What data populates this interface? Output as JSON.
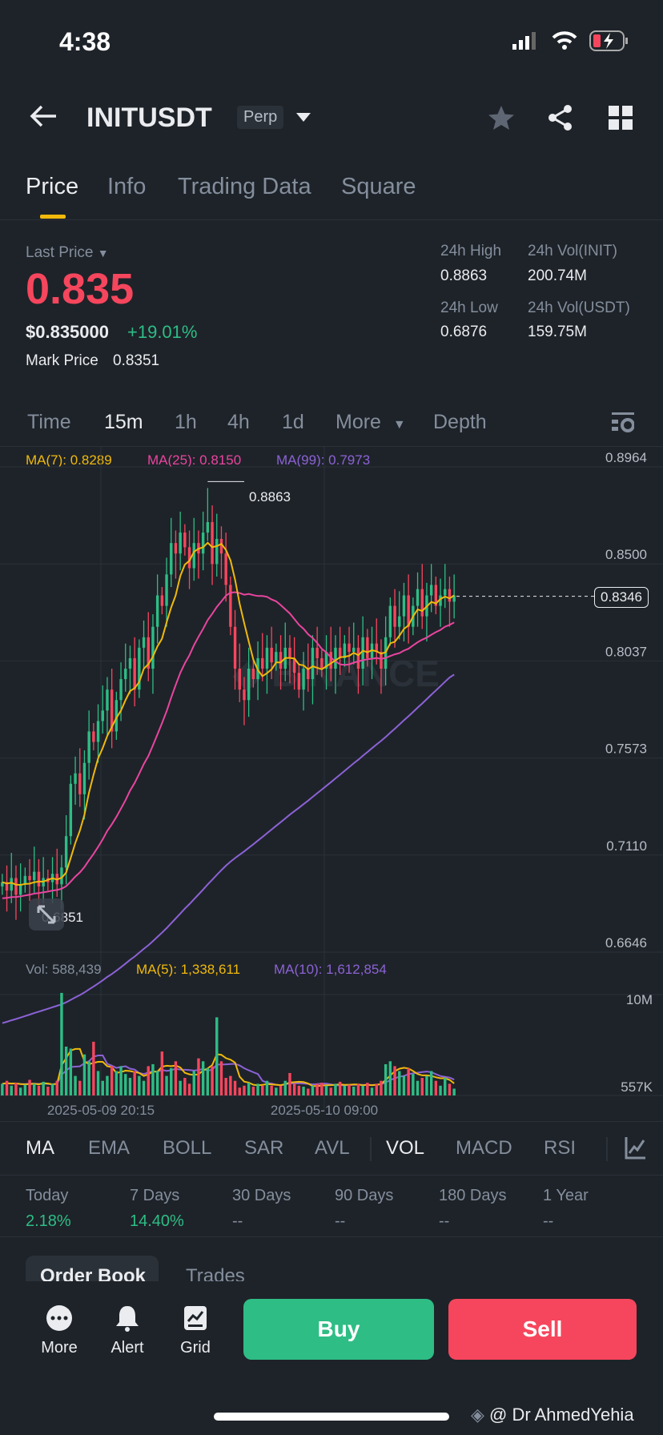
{
  "status": {
    "time": "4:38"
  },
  "header": {
    "symbol": "INITUSDT",
    "badge": "Perp"
  },
  "tabs": [
    "Price",
    "Info",
    "Trading Data",
    "Square"
  ],
  "ticker": {
    "last_price_label": "Last Price",
    "last_price": "0.835",
    "usd_price": "$0.835000",
    "change": "+19.01%",
    "mark_price_label": "Mark Price",
    "mark_price": "0.8351",
    "high_label": "24h High",
    "high": "0.8863",
    "low_label": "24h Low",
    "low": "0.6876",
    "vol_init_label": "24h Vol(INIT)",
    "vol_init": "200.74M",
    "vol_usdt_label": "24h Vol(USDT)",
    "vol_usdt": "159.75M"
  },
  "intervals": [
    "Time",
    "15m",
    "1h",
    "4h",
    "1d",
    "More",
    "Depth"
  ],
  "colors": {
    "up": "#2ebd85",
    "down": "#f6465d",
    "ma7": "#f0b90b",
    "ma25": "#e9459f",
    "ma99": "#8c62d6",
    "accent": "#f0b90b"
  },
  "chart_data": {
    "type": "candlestick",
    "ma_legend": {
      "ma7": "MA(7): 0.8289",
      "ma25": "MA(25): 0.8150",
      "ma99": "MA(99): 0.7973"
    },
    "y_ticks": [
      "0.8964",
      "0.8500",
      "0.8037",
      "0.7573",
      "0.7110",
      "0.6646"
    ],
    "ylim": [
      0.6646,
      0.8964
    ],
    "high_marker": "0.8863",
    "low_marker": "0.6851",
    "current_price_tag": "0.8346",
    "current_price": 0.8346,
    "closes": [
      0.698,
      0.694,
      0.7,
      0.692,
      0.697,
      0.701,
      0.699,
      0.703,
      0.696,
      0.7,
      0.698,
      0.702,
      0.697,
      0.705,
      0.72,
      0.745,
      0.75,
      0.74,
      0.755,
      0.77,
      0.765,
      0.775,
      0.78,
      0.79,
      0.77,
      0.785,
      0.795,
      0.8,
      0.805,
      0.79,
      0.81,
      0.815,
      0.8,
      0.82,
      0.835,
      0.83,
      0.845,
      0.86,
      0.855,
      0.865,
      0.858,
      0.848,
      0.86,
      0.855,
      0.865,
      0.87,
      0.85,
      0.862,
      0.855,
      0.84,
      0.82,
      0.8,
      0.79,
      0.785,
      0.8,
      0.795,
      0.805,
      0.8,
      0.81,
      0.803,
      0.808,
      0.8,
      0.81,
      0.805,
      0.798,
      0.79,
      0.8,
      0.795,
      0.81,
      0.805,
      0.8,
      0.808,
      0.8,
      0.81,
      0.805,
      0.812,
      0.808,
      0.81,
      0.8,
      0.815,
      0.805,
      0.812,
      0.808,
      0.8,
      0.815,
      0.83,
      0.82,
      0.825,
      0.835,
      0.82,
      0.83,
      0.838,
      0.825,
      0.835,
      0.84,
      0.83,
      0.835,
      0.838,
      0.832,
      0.835
    ],
    "volume_legend": {
      "vol": "Vol: 588,439",
      "ma5": "MA(5): 1,338,611",
      "ma10": "MA(10): 1,612,854"
    },
    "volume_ticks": [
      "10M",
      "557K"
    ],
    "volumes_m": [
      1.2,
      1.5,
      1.0,
      1.3,
      0.8,
      1.1,
      1.6,
      1.2,
      1.0,
      1.4,
      0.9,
      1.2,
      1.5,
      10.5,
      5,
      4.8,
      2.0,
      1.5,
      4.2,
      3.5,
      5.5,
      2.5,
      1.5,
      2.0,
      3.0,
      2.5,
      3.0,
      2.2,
      1.8,
      2.5,
      2.0,
      1.5,
      3.0,
      3.2,
      2.5,
      4.5,
      2.0,
      2.8,
      3.5,
      1.5,
      1.8,
      1.2,
      2.5,
      3.8,
      3.5,
      2.8,
      3.0,
      8.0,
      3.5,
      1.8,
      2.0,
      1.5,
      0.8,
      1.0,
      1.3,
      0.9,
      1.2,
      1.0,
      1.5,
      1.0,
      0.8,
      1.0,
      1.5,
      2.3,
      1.2,
      1.0,
      0.9,
      0.7,
      1.0,
      1.2,
      1.3,
      1.0,
      0.8,
      1.2,
      1.4,
      1.0,
      1.1,
      0.9,
      1.2,
      1.0,
      1.3,
      0.8,
      1.2,
      1.5,
      3.2,
      3.5,
      3.0,
      2.5,
      2.0,
      2.8,
      2.2,
      1.5,
      1.8,
      2.0,
      2.5,
      1.5,
      1.0,
      1.8,
      1.2,
      0.7
    ],
    "x_labels": [
      "2025-05-09 20:15",
      "2025-05-10 09:00"
    ]
  },
  "indicators": [
    "MA",
    "EMA",
    "BOLL",
    "SAR",
    "AVL",
    "VOL",
    "MACD",
    "RSI"
  ],
  "performance": [
    {
      "label": "Today",
      "value": "2.18%"
    },
    {
      "label": "7 Days",
      "value": "14.40%"
    },
    {
      "label": "30 Days",
      "value": "--"
    },
    {
      "label": "90 Days",
      "value": "--"
    },
    {
      "label": "180 Days",
      "value": "--"
    },
    {
      "label": "1 Year",
      "value": "--"
    }
  ],
  "book_tabs": [
    "Order Book",
    "Trades"
  ],
  "bottom": {
    "more": "More",
    "alert": "Alert",
    "grid": "Grid",
    "buy": "Buy",
    "sell": "Sell"
  },
  "watermark": "@ Dr AhmedYehia"
}
